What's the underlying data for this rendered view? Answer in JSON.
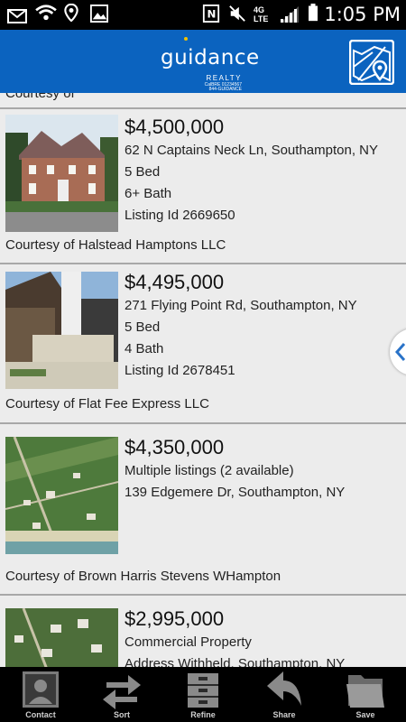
{
  "status_bar": {
    "time": "1:05 PM",
    "network": "4G LTE",
    "icons": [
      "mail-icon",
      "wifi-icon",
      "location-icon",
      "image-icon",
      "nfc-icon",
      "mute-icon",
      "signal-icon",
      "battery-icon"
    ]
  },
  "header": {
    "brand": "guidance",
    "sub": "REALTY",
    "tiny_line1": "CalBRE 01234567",
    "tiny_line2": "844-GUIDANCE",
    "map_icon": "map-pin-icon"
  },
  "listings": [
    {
      "price": "$4,500,000",
      "address": "62 N Captains Neck Ln,  Southampton, NY",
      "beds": "5 Bed",
      "baths": "6+ Bath",
      "listing_id": "Listing Id 2669650",
      "courtesy": "Courtesy of Halstead Hamptons LLC"
    },
    {
      "price": "$4,495,000",
      "address": "271 Flying Point Rd, Southampton, NY",
      "beds": "5 Bed",
      "baths": "4 Bath",
      "listing_id": "Listing Id 2678451",
      "courtesy": "Courtesy of Flat Fee Express LLC"
    },
    {
      "price": "$4,350,000",
      "multiple": "Multiple listings (2 available)",
      "address": "139 Edgemere Dr,  Southampton, NY",
      "courtesy": "Courtesy of Brown Harris Stevens WHampton"
    },
    {
      "price": "$2,995,000",
      "type": "Commercial Property",
      "address": "Address Withheld,  Southampton, NY"
    }
  ],
  "tabs": [
    {
      "label": "Contact",
      "icon": "contact-icon"
    },
    {
      "label": "Sort",
      "icon": "sort-arrows-icon"
    },
    {
      "label": "Refine",
      "icon": "refine-cabinet-icon"
    },
    {
      "label": "Share",
      "icon": "share-arrow-icon"
    },
    {
      "label": "Save",
      "icon": "folder-icon"
    }
  ],
  "colors": {
    "header_blue": "#0b63bf",
    "accent_gold": "#f2c200",
    "chevron_blue": "#2a73c8"
  }
}
